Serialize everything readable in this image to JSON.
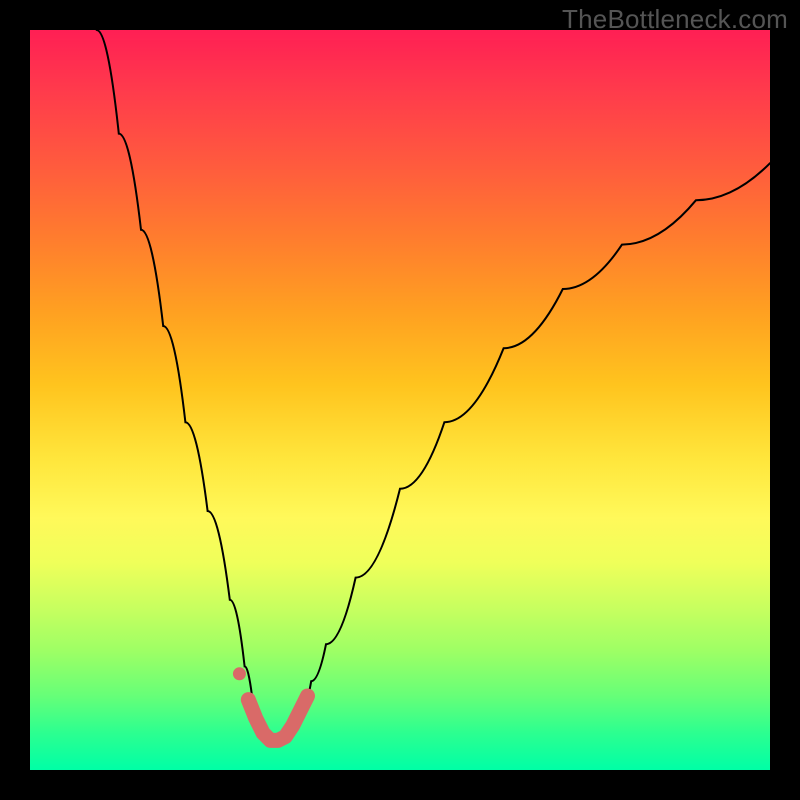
{
  "watermark": "TheBottleneck.com",
  "chart_data": {
    "type": "line",
    "title": "",
    "xlabel": "",
    "ylabel": "",
    "xlim": [
      0,
      100
    ],
    "ylim": [
      0,
      100
    ],
    "description": "Bottleneck curve over a vertical red-to-green gradient. Y encodes bottleneck percentage (red=high at top, green=low at bottom). The black curve drops from top-left toward a minimum near x≈33 then rises more slowly toward the right. A short salmon-colored segment highlights the trough region.",
    "series": [
      {
        "name": "bottleneck-curve",
        "color": "#000000",
        "x": [
          9,
          12,
          15,
          18,
          21,
          24,
          27,
          29,
          30,
          31,
          32,
          33,
          34,
          35,
          36,
          37,
          38,
          40,
          44,
          50,
          56,
          64,
          72,
          80,
          90,
          100
        ],
        "y": [
          100,
          86,
          73,
          60,
          47,
          35,
          23,
          14,
          10,
          7,
          4.5,
          3.5,
          3.5,
          4.5,
          6.5,
          9,
          12,
          17,
          26,
          38,
          47,
          57,
          65,
          71,
          77,
          82
        ]
      },
      {
        "name": "highlight-points",
        "color": "#d96a68",
        "x": [
          29.5,
          30.5,
          31.5,
          32.5,
          33.5,
          34.5,
          35.5,
          36.5,
          37.5
        ],
        "y": [
          9.5,
          7,
          5,
          4,
          4,
          4.5,
          6,
          8,
          10
        ]
      }
    ],
    "gradient_stops": [
      {
        "pos": 0,
        "color": "#ff1f54"
      },
      {
        "pos": 50,
        "color": "#ffe63c"
      },
      {
        "pos": 100,
        "color": "#00ffa6"
      }
    ]
  }
}
